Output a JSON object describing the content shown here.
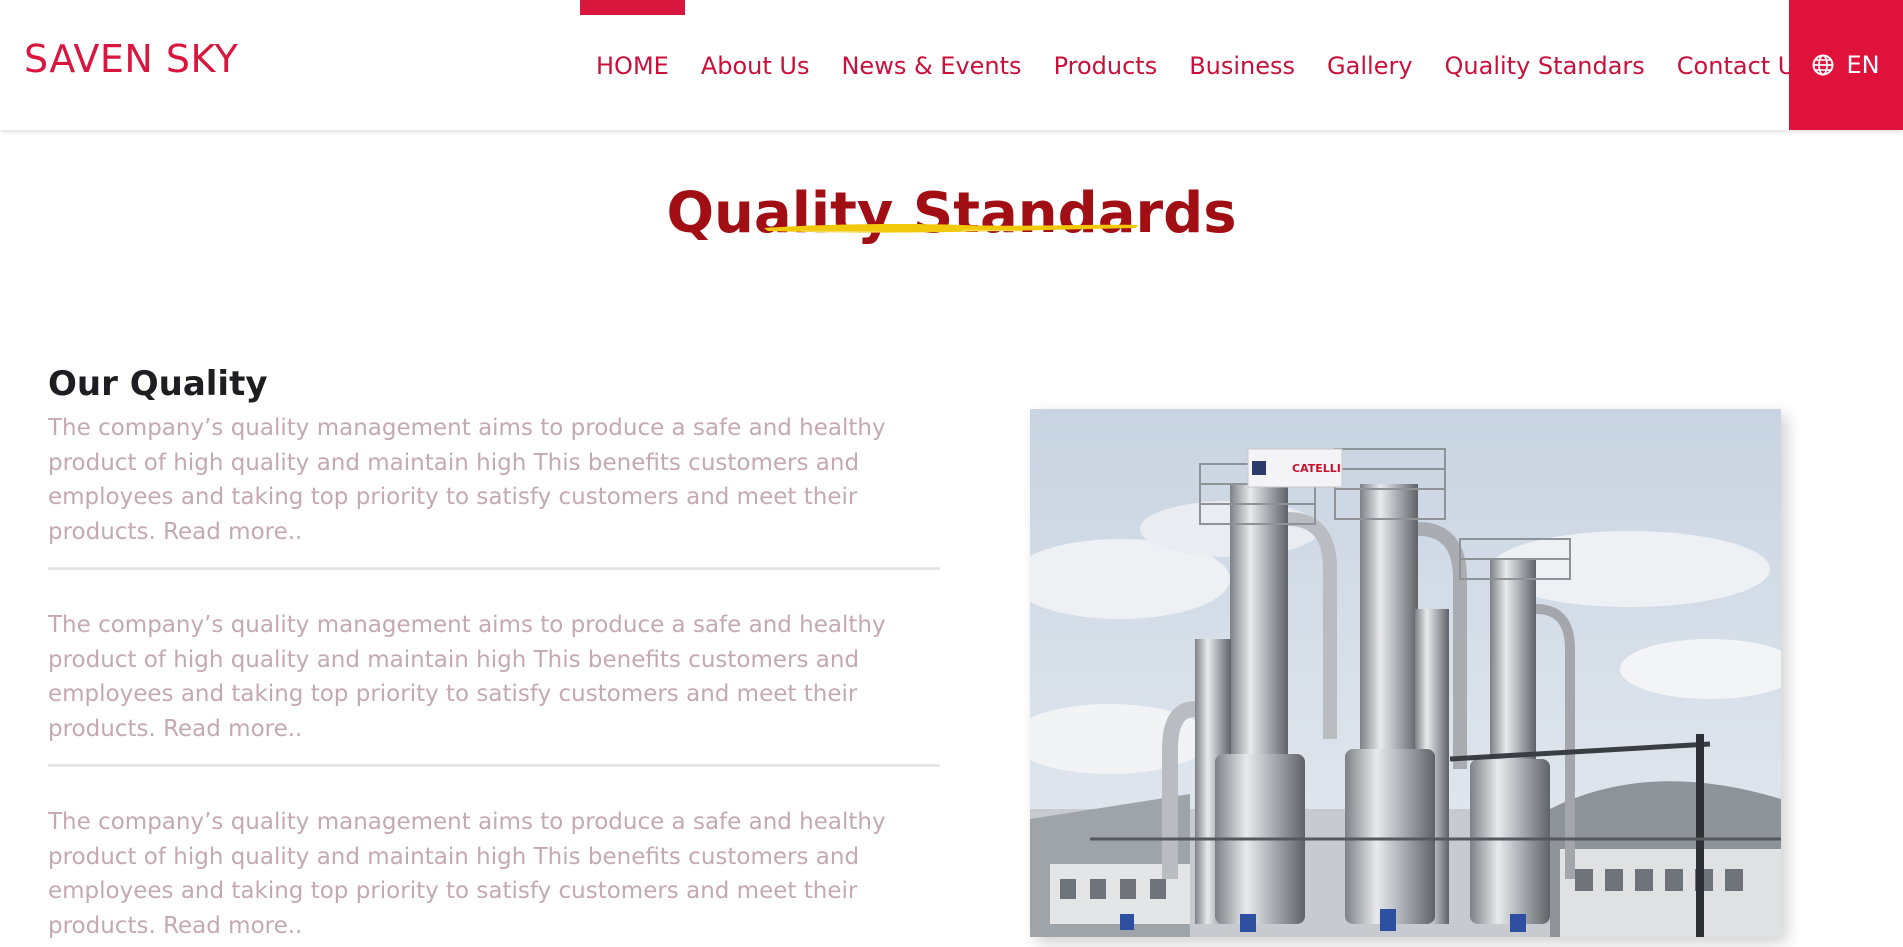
{
  "header": {
    "logo": "SAVEN SKY",
    "nav": [
      {
        "label": "HOME",
        "active": true
      },
      {
        "label": "About Us"
      },
      {
        "label": "News & Events"
      },
      {
        "label": "Products"
      },
      {
        "label": "Business"
      },
      {
        "label": "Gallery"
      },
      {
        "label": "Quality Standars"
      },
      {
        "label": "Contact Us"
      }
    ],
    "language": "EN",
    "language_icon": "globe-icon"
  },
  "page": {
    "title": "Quality Standards"
  },
  "quality": {
    "heading": "Our Quality",
    "paragraphs": [
      "The company’s quality management aims to produce a safe and healthy product of high quality and maintain high This benefits customers and employees and taking top priority to satisfy customers and meet their products. Read more..",
      "The company’s quality management aims to produce a safe and healthy product of high quality and maintain high This benefits customers and employees and taking top priority to satisfy customers and meet their products. Read more..",
      "The company’s quality management aims to produce a safe and healthy product of high quality and maintain high This benefits customers and employees and taking top priority to satisfy customers and meet their products. Read more.."
    ],
    "photo_sign_text": "CATELLI"
  },
  "colors": {
    "brand_red": "#d9163e",
    "title_red": "#a10f14",
    "accent_yellow": "#f2c90a",
    "paragraph_text": "#c4a9b2"
  }
}
